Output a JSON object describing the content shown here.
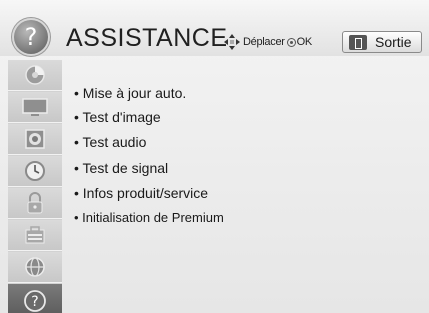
{
  "header": {
    "title": "ASSISTANCE",
    "nav_hint_move": "Déplacer",
    "nav_hint_ok": "OK",
    "exit_label": "Sortie",
    "help_glyph": "?"
  },
  "sidebar": {
    "items": [
      {
        "icon": "disc-icon",
        "active": false
      },
      {
        "icon": "picture-icon",
        "active": false
      },
      {
        "icon": "speaker-icon",
        "active": false
      },
      {
        "icon": "clock-icon",
        "active": false
      },
      {
        "icon": "lock-icon",
        "active": false
      },
      {
        "icon": "toolbox-icon",
        "active": false
      },
      {
        "icon": "network-icon",
        "active": false
      },
      {
        "icon": "help-icon",
        "active": true,
        "glyph": "?"
      }
    ]
  },
  "menu": {
    "items": [
      {
        "label": "• Mise à jour auto."
      },
      {
        "label": "• Test d'image"
      },
      {
        "label": "• Test audio"
      },
      {
        "label": "• Test de signal"
      },
      {
        "label": "• Infos produit/service"
      },
      {
        "label": "• Initialisation de Premium"
      }
    ]
  },
  "colors": {
    "background": "#ececec",
    "sidebar": "#d2d2d2",
    "active_item": "#6a6a6a",
    "text": "#1a1a1a"
  }
}
